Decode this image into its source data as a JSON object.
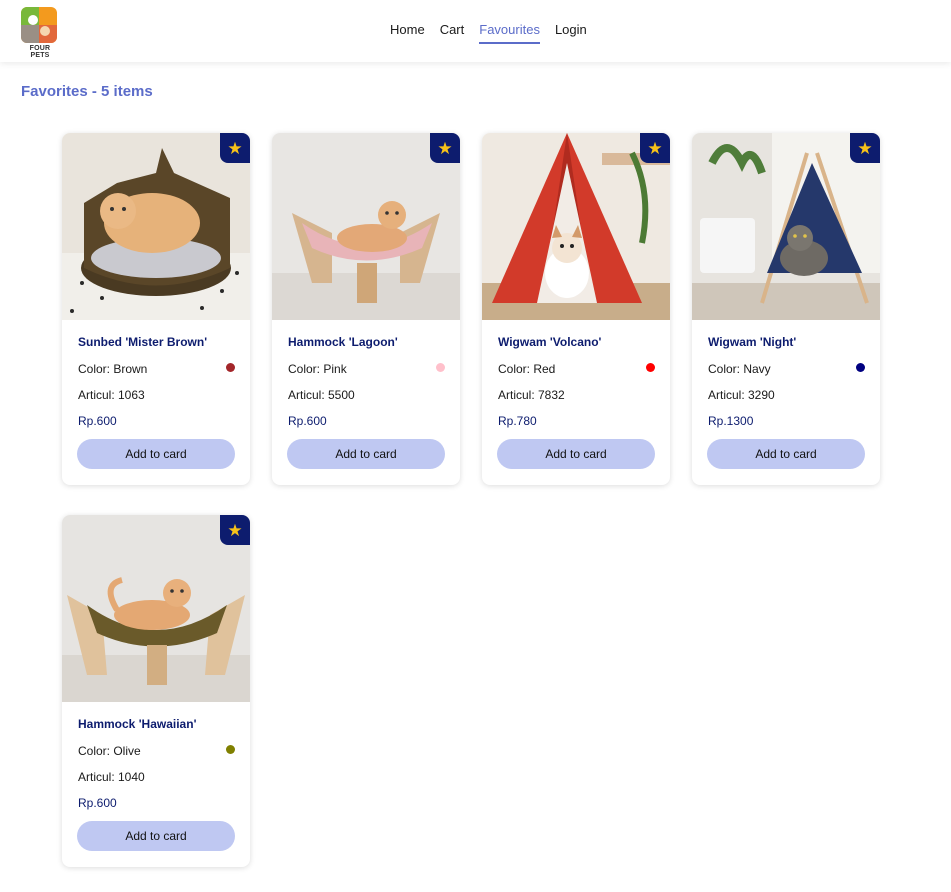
{
  "header": {
    "logo_text": "FOUR PETS",
    "nav": [
      {
        "label": "Home",
        "active": false
      },
      {
        "label": "Cart",
        "active": false
      },
      {
        "label": "Favourites",
        "active": true
      },
      {
        "label": "Login",
        "active": false
      }
    ]
  },
  "page": {
    "title": "Favorites - 5 items"
  },
  "favourite_icon": "star-icon",
  "products": [
    {
      "name": "Sunbed 'Mister Brown'",
      "color_text": "Color: Brown",
      "color_hex": "#a3262a",
      "articul": "Articul: 1063",
      "price": "Rp.600",
      "button": "Add to card"
    },
    {
      "name": "Hammock 'Lagoon'",
      "color_text": "Color: Pink",
      "color_hex": "#ffc0cb",
      "articul": "Articul: 5500",
      "price": "Rp.600",
      "button": "Add to card"
    },
    {
      "name": "Wigwam 'Volcano'",
      "color_text": "Color: Red",
      "color_hex": "#ff0000",
      "articul": "Articul: 7832",
      "price": "Rp.780",
      "button": "Add to card"
    },
    {
      "name": "Wigwam 'Night'",
      "color_text": "Color: Navy",
      "color_hex": "#000080",
      "articul": "Articul: 3290",
      "price": "Rp.1300",
      "button": "Add to card"
    },
    {
      "name": "Hammock 'Hawaiian'",
      "color_text": "Color: Olive",
      "color_hex": "#808000",
      "articul": "Articul: 1040",
      "price": "Rp.600",
      "button": "Add to card"
    }
  ]
}
